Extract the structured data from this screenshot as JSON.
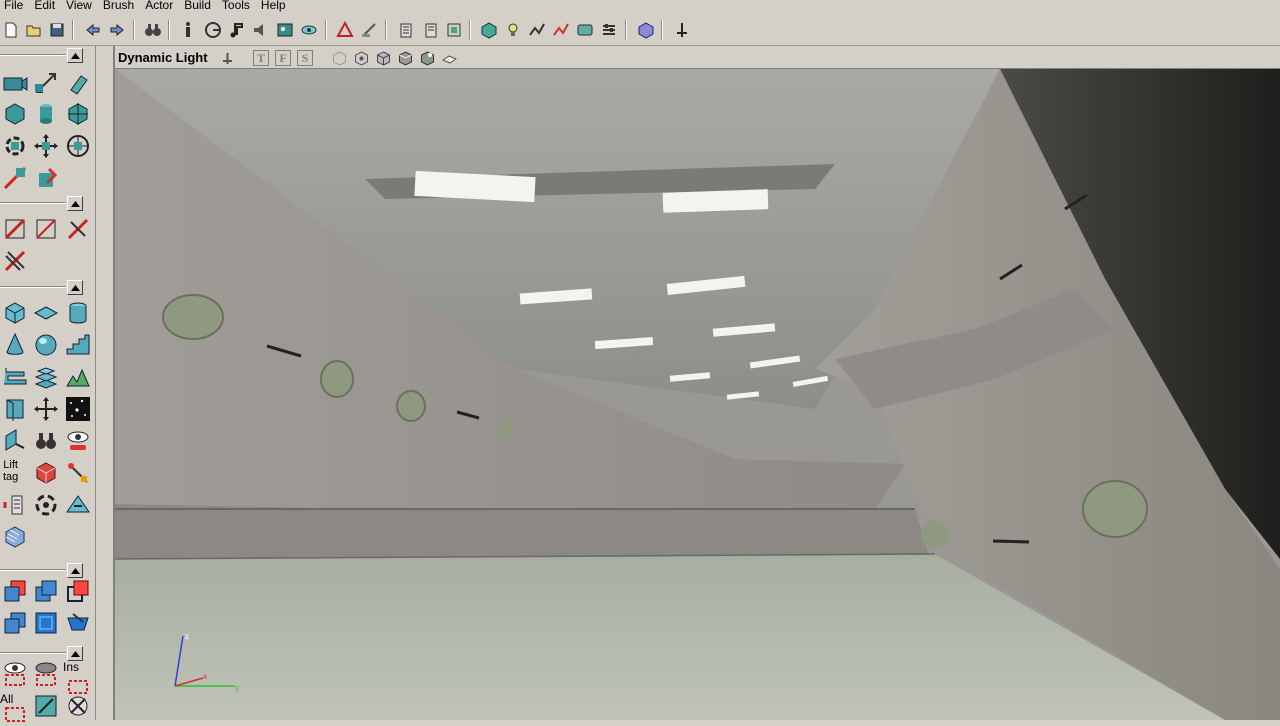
{
  "menu": [
    "File",
    "Edit",
    "View",
    "Brush",
    "Actor",
    "Build",
    "Tools",
    "Help"
  ],
  "toolbar_icons": [
    "new-file-icon",
    "open-folder-icon",
    "save-icon",
    "undo-icon",
    "redo-icon",
    "binoculars-icon",
    "actor-props-icon",
    "group-browser-icon",
    "music-browser-icon",
    "sound-browser-icon",
    "texture-browser-icon",
    "mesh-browser-icon",
    "2d-editor-icon",
    "build-geometry-icon",
    "build-props-icon",
    "build-lighting-icon",
    "build-paths-icon",
    "build-all-icon",
    "play-level-icon",
    "cube-icon",
    "lock-icon"
  ],
  "viewport": {
    "title": "Dynamic Light",
    "mode_buttons": [
      "T",
      "F",
      "S"
    ]
  },
  "left_panel": {
    "lift_tag_label_line1": "Lift",
    "lift_tag_label_line2": "tag",
    "ins_label": "Ins",
    "all_label": "All"
  },
  "axis": {
    "x": "x",
    "y": "y",
    "z": "z"
  },
  "colors": {
    "chrome": "#d4d0c8",
    "wall": "#9a948e",
    "floor": "#b3b8ad",
    "light_strip": "#f2f4f0",
    "axis_x": "#d03030",
    "axis_y": "#30c030",
    "axis_z": "#3040e0"
  }
}
